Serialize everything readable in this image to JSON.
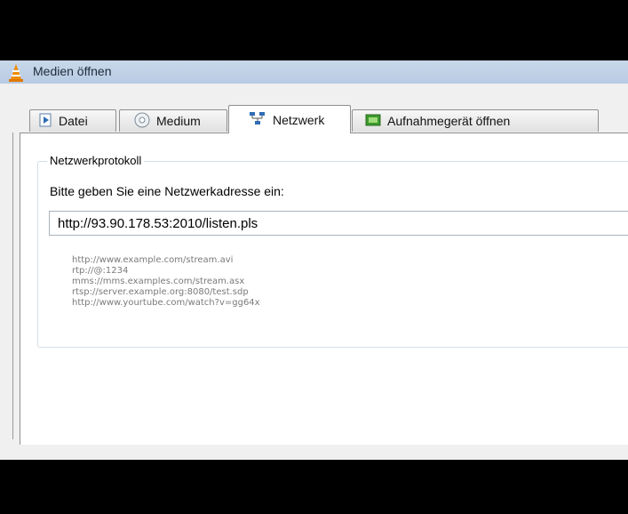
{
  "window": {
    "title": "Medien öffnen",
    "icon": "vlc-cone-icon"
  },
  "tabs": [
    {
      "label": "Datei",
      "icon": "file-icon",
      "active": false
    },
    {
      "label": "Medium",
      "icon": "disc-icon",
      "active": false
    },
    {
      "label": "Netzwerk",
      "icon": "network-icon",
      "active": true
    },
    {
      "label": "Aufnahmegerät öffnen",
      "icon": "capture-device-icon",
      "active": false
    }
  ],
  "network": {
    "group_label": "Netzwerkprotokoll",
    "prompt": "Bitte geben Sie eine Netzwerkadresse ein:",
    "url_value": "http://93.90.178.53:2010/listen.pls",
    "examples": [
      "http://www.example.com/stream.avi",
      "rtp://@:1234",
      "mms://mms.examples.com/stream.asx",
      "rtsp://server.example.org:8080/test.sdp",
      "http://www.yourtube.com/watch?v=gg64x"
    ]
  },
  "colors": {
    "vlc_orange": "#f08c00",
    "titlebar": "#bfd1e7"
  }
}
